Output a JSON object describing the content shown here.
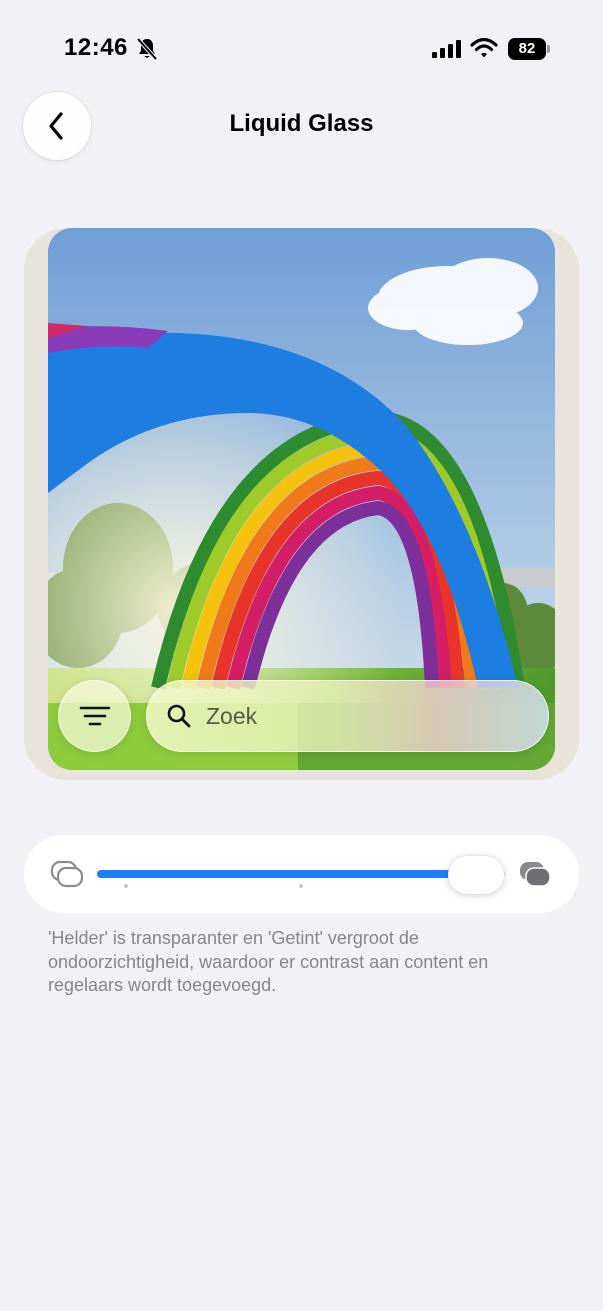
{
  "status_bar": {
    "time": "12:46",
    "battery_level": "82",
    "icons": [
      "bell-muted-icon",
      "cellular-signal-icon",
      "wifi-icon",
      "battery-icon"
    ]
  },
  "nav": {
    "back_icon": "chevron-left-icon",
    "title": "Liquid Glass"
  },
  "preview": {
    "image": "photo-rainbow-arch",
    "menu_icon": "filter-lines-icon",
    "search": {
      "placeholder": "Zoek",
      "value": ""
    }
  },
  "appearance_slider": {
    "left_icon": "clear-glass-icon",
    "right_icon": "tinted-glass-icon",
    "value": 0.93,
    "tick_positions": [
      0.07,
      0.5
    ],
    "accent_color": "#1d7ef8"
  },
  "footnote": "'Helder' is transparanter en 'Getint' vergroot de ondoorzichtigheid, waardoor er contrast aan content en regelaars wordt toegevoegd."
}
